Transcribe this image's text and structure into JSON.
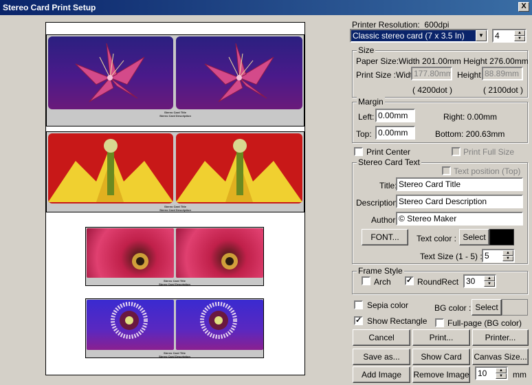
{
  "window": {
    "title": "Stereo Card Print Setup",
    "close_glyph": "X"
  },
  "cards": [
    {
      "title": "Stereo Card Title",
      "description": "Stereo Card Description",
      "subject": "pink lily on purple"
    },
    {
      "title": "Stereo Card Title",
      "description": "Stereo Card Description",
      "subject": "red tulip close-up"
    },
    {
      "title": "Stereo Card Title",
      "description": "Stereo Card Description",
      "subject": "red tulip center"
    },
    {
      "title": "Stereo Card Title",
      "description": "Stereo Card Description",
      "subject": "passion flower on blue"
    }
  ],
  "printer": {
    "resolution_label": "Printer Resolution:",
    "resolution_value": "600dpi",
    "card_type": "Classic stereo card (7 x 3.5 In)",
    "copies": "4"
  },
  "size": {
    "group_label": "Size",
    "paper_size": "Paper Size:Width 201.00mm Height 276.00mm",
    "print_size_label": "Print Size :Width",
    "width_value": "177.80mm",
    "height_label": "Height",
    "height_value": "88.89mm",
    "width_dots": "( 4200dot )",
    "height_dots": "( 2100dot )"
  },
  "margin": {
    "group_label": "Margin",
    "left_label": "Left:",
    "left_value": "0.00mm",
    "top_label": "Top:",
    "top_value": "0.00mm",
    "right_text": "Right:  0.00mm",
    "bottom_text": "Bottom:   200.63mm"
  },
  "options": {
    "print_center": "Print Center",
    "print_full_size": "Print Full Size"
  },
  "stereo_text": {
    "group_label": "Stereo Card Text",
    "text_position": "Text position (Top)",
    "title_label": "Title:",
    "title_value": "Stereo Card Title",
    "description_label": "Description:",
    "description_value": "Stereo Card Description",
    "author_label": "Author:",
    "author_value": "© Stereo Maker",
    "font_button": "FONT...",
    "text_color_label": "Text color :",
    "select_button": "Select",
    "text_color": "#000000",
    "text_size_label": "Text Size (1 - 5) :",
    "text_size_value": "5"
  },
  "frame": {
    "group_label": "Frame Style",
    "arch": "Arch",
    "roundrect": "RoundRect",
    "roundrect_value": "30"
  },
  "bottom": {
    "sepia": "Sepia color",
    "bg_color_label": "BG color :",
    "bg_select": "Select",
    "bg_color": "#d4d0c8",
    "show_rectangle": "Show Rectangle",
    "full_page": "Full-page (BG color)",
    "cancel": "Cancel",
    "print": "Print...",
    "printer": "Printer...",
    "save_as": "Save as...",
    "show_card": "Show Card",
    "canvas_size": "Canvas Size...",
    "add_image": "Add Image",
    "remove_image": "Remove Image",
    "spacing_value": "10",
    "spacing_unit": "mm"
  }
}
